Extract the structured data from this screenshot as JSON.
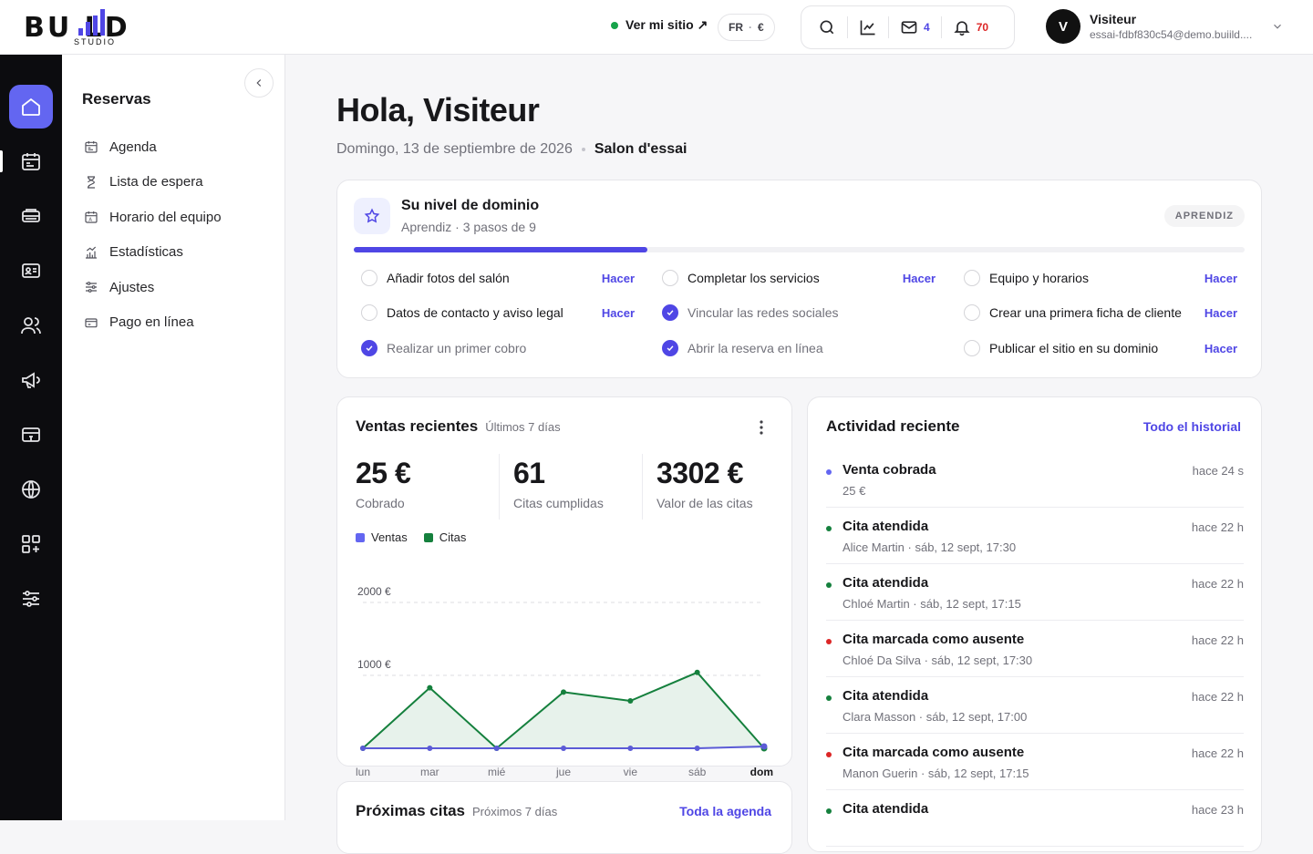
{
  "brand": {
    "logo_text": "BU  LD",
    "logo_sub": "STUDIO"
  },
  "header": {
    "site_link": "Ver mi sitio ↗",
    "lang": "FR",
    "currency": "€",
    "mail_count": "4",
    "notif_count": "70",
    "user_initial": "V",
    "user_name": "Visiteur",
    "user_email": "essai-fdbf830c54@demo.buiild...."
  },
  "rail": {
    "items": [
      "home-icon",
      "calendar-icon",
      "bookings-icon",
      "contact-card-icon",
      "users-icon",
      "megaphone-icon",
      "payment-terminal-icon",
      "globe-icon",
      "apps-icon",
      "sliders-icon"
    ]
  },
  "subnav": {
    "title": "Reservas",
    "items": [
      {
        "label": "Agenda",
        "icon": "calendar-icon"
      },
      {
        "label": "Lista de espera",
        "icon": "hourglass-icon"
      },
      {
        "label": "Horario del equipo",
        "icon": "team-calendar-icon"
      },
      {
        "label": "Estadísticas",
        "icon": "stats-icon"
      },
      {
        "label": "Ajustes",
        "icon": "sliders-icon"
      },
      {
        "label": "Pago en línea",
        "icon": "card-icon"
      }
    ]
  },
  "greeting": {
    "title": "Hola, Visiteur",
    "date": "Domingo, 13 de septiembre de 2026",
    "salon": "Salon d'essai"
  },
  "mastery": {
    "title": "Su nivel de dominio",
    "subtitle": "Aprendiz · 3 pasos de 9",
    "badge": "APRENDIZ",
    "progress": 0.33,
    "tasks": [
      {
        "label": "Añadir fotos del salón",
        "done": false,
        "action": "Hacer"
      },
      {
        "label": "Completar los servicios",
        "done": false,
        "action": "Hacer"
      },
      {
        "label": "Equipo y horarios",
        "done": false,
        "action": "Hacer"
      },
      {
        "label": "Datos de contacto y aviso legal",
        "done": false,
        "action": "Hacer"
      },
      {
        "label": "Vincular las redes sociales",
        "done": true,
        "action": ""
      },
      {
        "label": "Crear una primera ficha de cliente",
        "done": false,
        "action": "Hacer"
      },
      {
        "label": "Realizar un primer cobro",
        "done": true,
        "action": ""
      },
      {
        "label": "Abrir la reserva en línea",
        "done": true,
        "action": ""
      },
      {
        "label": "Publicar el sitio en su dominio",
        "done": false,
        "action": "Hacer"
      }
    ]
  },
  "sales": {
    "title": "Ventas recientes",
    "period": "Últimos 7 días",
    "kpis": [
      {
        "value": "25 €",
        "label": "Cobrado"
      },
      {
        "value": "61",
        "label": "Citas cumplidas"
      },
      {
        "value": "3302 €",
        "label": "Valor de las citas"
      }
    ]
  },
  "chart_data": {
    "type": "area",
    "categories": [
      "lun",
      "mar",
      "mié",
      "jue",
      "vie",
      "sáb",
      "dom"
    ],
    "highlight_category": "dom",
    "ylim": [
      0,
      2000
    ],
    "yticks": [
      {
        "value": 1000,
        "label": "1000 €"
      },
      {
        "value": 2000,
        "label": "2000 €"
      }
    ],
    "grid": true,
    "legend_position": "top-left",
    "series": [
      {
        "name": "Ventas",
        "color": "#5b5bd6",
        "values": [
          0,
          0,
          0,
          0,
          0,
          0,
          25
        ]
      },
      {
        "name": "Citas",
        "color": "#15803d",
        "values": [
          0,
          830,
          0,
          770,
          650,
          1040,
          0
        ]
      }
    ]
  },
  "activity": {
    "title": "Actividad reciente",
    "link": "Todo el historial",
    "items": [
      {
        "title": "Venta cobrada",
        "sub": "25 €",
        "when": "hace 24 s",
        "color": "#6366f1"
      },
      {
        "title": "Cita atendida",
        "sub": "Alice Martin · sáb, 12 sept, 17:30",
        "when": "hace 22 h",
        "color": "#15803d"
      },
      {
        "title": "Cita atendida",
        "sub": "Chloé Martin · sáb, 12 sept, 17:15",
        "when": "hace 22 h",
        "color": "#15803d"
      },
      {
        "title": "Cita marcada como ausente",
        "sub": "Chloé Da Silva · sáb, 12 sept, 17:30",
        "when": "hace 22 h",
        "color": "#dc2626"
      },
      {
        "title": "Cita atendida",
        "sub": "Clara Masson · sáb, 12 sept, 17:00",
        "when": "hace 22 h",
        "color": "#15803d"
      },
      {
        "title": "Cita marcada como ausente",
        "sub": "Manon Guerin · sáb, 12 sept, 17:15",
        "when": "hace 22 h",
        "color": "#dc2626"
      },
      {
        "title": "Cita atendida",
        "sub": "",
        "when": "hace 23 h",
        "color": "#15803d"
      }
    ]
  },
  "upcoming": {
    "title": "Próximas citas",
    "period": "Próximos 7 días",
    "link": "Toda la agenda"
  }
}
